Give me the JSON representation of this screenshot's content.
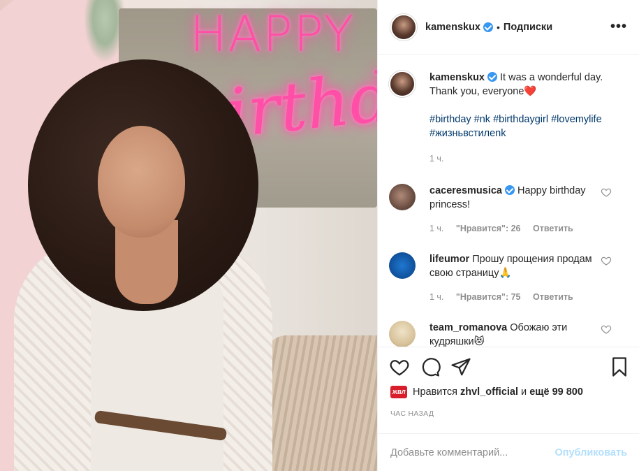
{
  "post": {
    "owner": {
      "username": "kamenskux",
      "follow_label": "Подписки",
      "separator": "•",
      "more_label": "•••"
    },
    "caption": {
      "username": "kamenskux",
      "text": "It was a wonderful day. Thank you, everyone",
      "emoji": "❤️",
      "hashtags": "#birthday #nk #birthdaygirl #lovemylife #жизньвстилеnk",
      "time": "1 ч."
    },
    "comments": [
      {
        "username": "caceresmusica",
        "verified": true,
        "text": "Happy birthday princess!",
        "time": "1 ч.",
        "likes": "\"Нравится\": 26",
        "reply": "Ответить"
      },
      {
        "username": "lifeumor",
        "verified": false,
        "text": "Прошу прощения продам свою страницу🙏",
        "time": "1 ч.",
        "likes": "\"Нравится\": 75",
        "reply": "Ответить"
      },
      {
        "username": "team_romanova",
        "verified": false,
        "text": "Обожаю эти кудряшки😻",
        "time": "",
        "likes": "",
        "reply": ""
      }
    ],
    "likes_line": {
      "badge": "ЖВЛ",
      "prefix": "Нравится",
      "user": "zhvl_official",
      "middle": "и",
      "rest": "ещё 99 800"
    },
    "time_ago": "ЧАС НАЗАД",
    "comment_box": {
      "placeholder": "Добавьте комментарий...",
      "publish_label": "Опубликовать"
    },
    "photo": {
      "neon_line1": "HAPPY",
      "neon_line2": "birthday"
    }
  },
  "colors": {
    "link": "#00376b",
    "verified": "#3897f0",
    "muted": "#8e8e8e",
    "publish_disabled": "#b2dffc",
    "heart": "#ed4956"
  }
}
